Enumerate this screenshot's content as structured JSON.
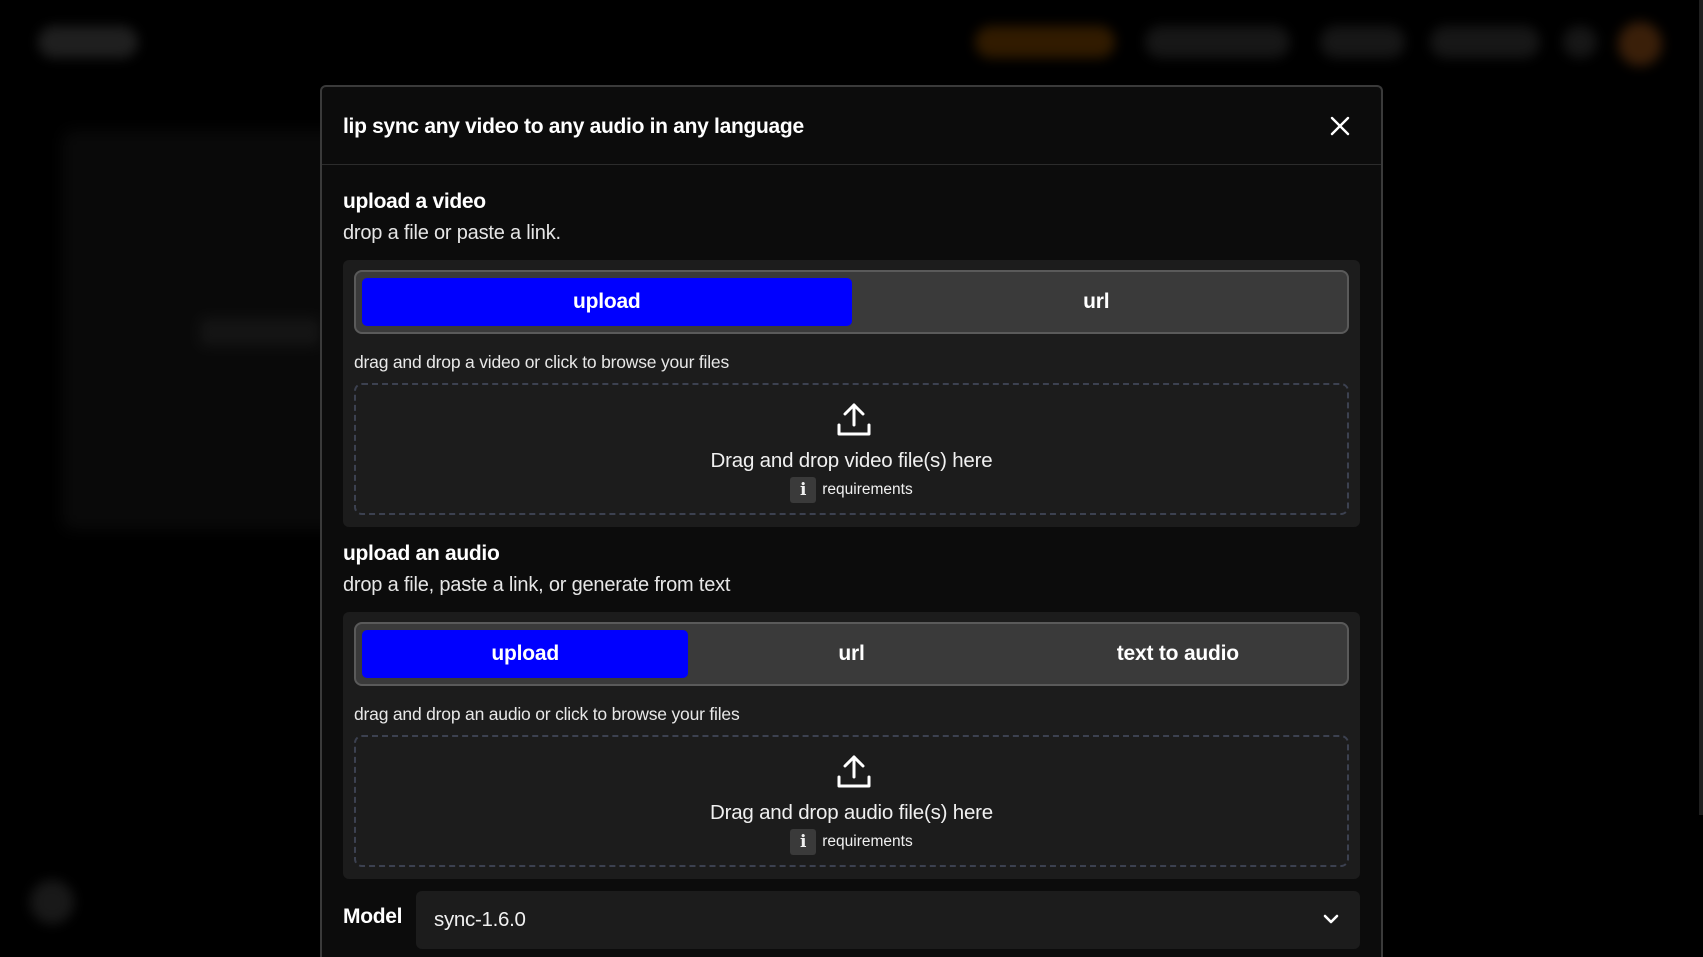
{
  "modal": {
    "title": "lip sync any video to any audio in any language"
  },
  "video": {
    "title": "upload a video",
    "subtitle": "drop a file or paste a link.",
    "tabs": [
      {
        "label": "upload",
        "active": true
      },
      {
        "label": "url",
        "active": false
      }
    ],
    "hint": "drag and drop a video or click to browse your files",
    "drop_text": "Drag and drop video file(s) here",
    "requirements": "requirements"
  },
  "audio": {
    "title": "upload an audio",
    "subtitle": "drop a file, paste a link, or generate from text",
    "tabs": [
      {
        "label": "upload",
        "active": true
      },
      {
        "label": "url",
        "active": false
      },
      {
        "label": "text to audio",
        "active": false
      }
    ],
    "hint": "drag and drop an audio or click to browse your files",
    "drop_text": "Drag and drop audio file(s) here",
    "requirements": "requirements"
  },
  "model": {
    "label": "Model",
    "selected": "sync-1.6.0"
  },
  "icons": {
    "close": "close-icon",
    "upload": "upload-icon",
    "info": "info-icon",
    "chevron": "chevron-down-icon"
  },
  "info_glyph": "i",
  "colors": {
    "accent": "#0000ff",
    "modal_bg": "#0c0c0c",
    "panel_bg": "#1c1c1c"
  }
}
